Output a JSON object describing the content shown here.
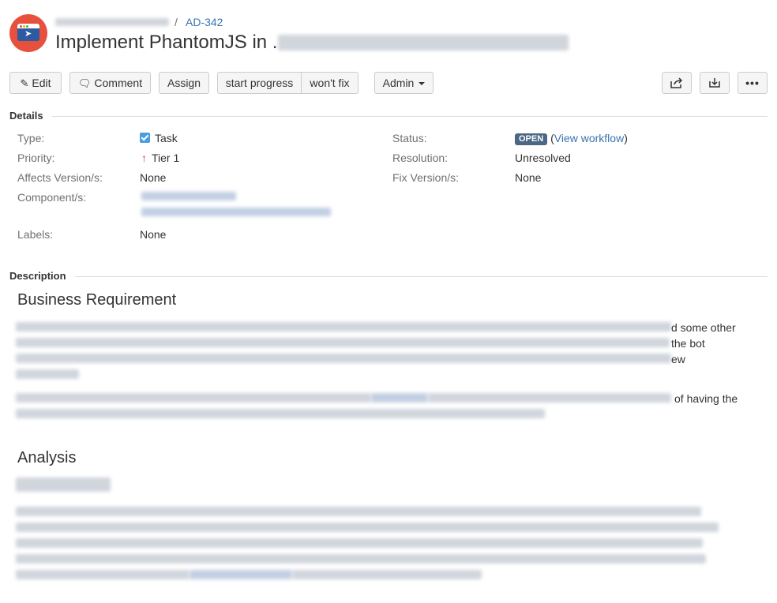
{
  "header": {
    "project_icon": "project-window-icon",
    "breadcrumb_separator": "/",
    "issue_key": "AD-342",
    "title": "Implement PhantomJS in ."
  },
  "toolbar": {
    "edit": "Edit",
    "comment": "Comment",
    "assign": "Assign",
    "start_progress": "start progress",
    "wont_fix": "won't fix",
    "admin": "Admin",
    "share_icon": "share-icon",
    "export_icon": "export-icon",
    "more_icon": "more-icon"
  },
  "details": {
    "heading": "Details",
    "type_label": "Type:",
    "type_value": "Task",
    "priority_label": "Priority:",
    "priority_value": "Tier 1",
    "affects_label": "Affects Version/s:",
    "affects_value": "None",
    "component_label": "Component/s:",
    "labels_label": "Labels:",
    "labels_value": "None",
    "status_label": "Status:",
    "status_value": "OPEN",
    "view_workflow_open": "(",
    "view_workflow": "View workflow",
    "view_workflow_close": ")",
    "resolution_label": "Resolution:",
    "resolution_value": "Unresolved",
    "fix_label": "Fix Version/s:",
    "fix_value": "None"
  },
  "description": {
    "heading": "Description",
    "business_heading": "Business Requirement",
    "frag1": "d some other",
    "frag2": "the bot",
    "frag3": "ew",
    "frag4": "of having the",
    "analysis_heading": "Analysis"
  },
  "colors": {
    "accent_link": "#3b73af",
    "status_lozenge": "#4a6785",
    "avatar_bg": "#e8503e",
    "priority_arrow": "#d04437"
  }
}
